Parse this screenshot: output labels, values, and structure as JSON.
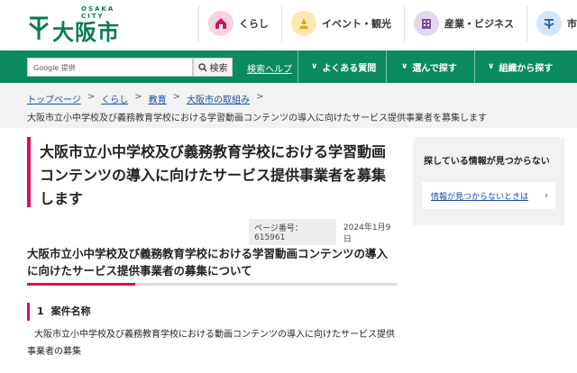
{
  "header": {
    "logo_sub": "OSAKA CITY",
    "logo_text": "大阪市",
    "nav": [
      {
        "label": "くらし",
        "icon": "home-icon",
        "color": "#f7d3dc"
      },
      {
        "label": "イベント・観光",
        "icon": "event-icon",
        "color": "#fbe9b0"
      },
      {
        "label": "産業・ビジネス",
        "icon": "business-icon",
        "color": "#e3d9ee"
      },
      {
        "label": "市政",
        "icon": "city-icon",
        "color": "#d4e6f5"
      }
    ]
  },
  "search": {
    "placeholder": "Google 提供",
    "button_label": "検索",
    "help_link": "検索ヘルプ"
  },
  "gnav": [
    {
      "label": "よくある質問"
    },
    {
      "label": "選んで探す"
    },
    {
      "label": "組織から探す"
    }
  ],
  "breadcrumb": {
    "items": [
      "トップページ",
      "くらし",
      "教育",
      "大阪市の取組み"
    ],
    "current": "大阪市立小中学校及び義務教育学校における学習動画コンテンツの導入に向けたサービス提供事業者を募集します"
  },
  "main": {
    "title": "大阪市立小中学校及び義務教育学校における学習動画コンテンツの導入に向けたサービス提供事業者を募集します",
    "page_number": "ページ番号：615961",
    "date": "2024年1月9日",
    "subheading": "大阪市立小中学校及び義務教育学校における学習動画コンテンツの導入に向けたサービス提供事業者の募集について",
    "section_number": "1",
    "section_title": "案件名称",
    "section_body": "大阪市立小中学校及び義務教育学校における動画コンテンツの導入に向けたサービス提供事業者の募集"
  },
  "sidebar": {
    "title": "探している情報が見つからない",
    "link_label": "情報が見つからないときは"
  },
  "colors": {
    "brand_green": "#0a8a5e",
    "accent_pink": "#d0115d",
    "link_blue": "#1a4fa0"
  }
}
